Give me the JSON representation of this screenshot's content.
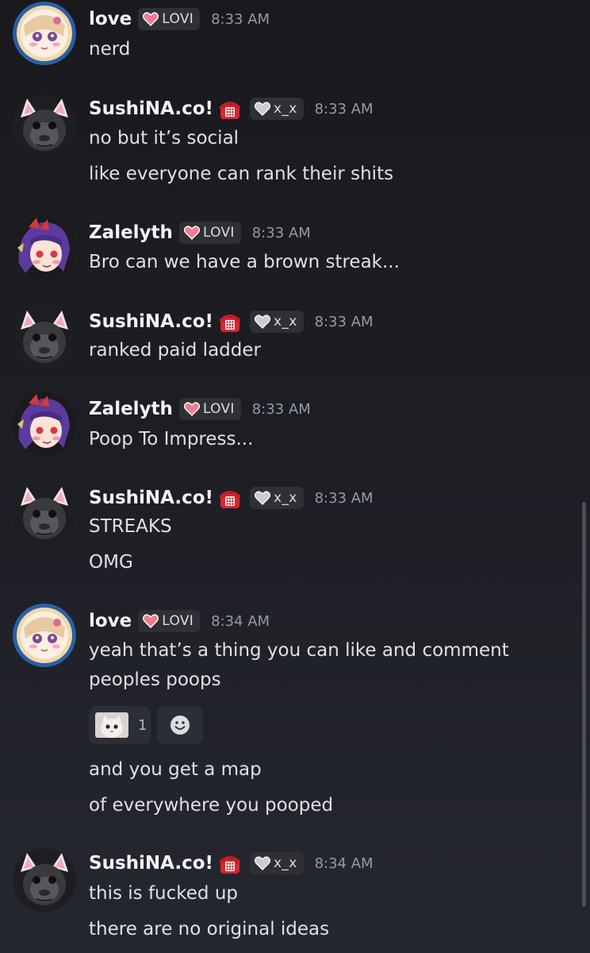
{
  "messages": [
    {
      "user": "love",
      "avatar": "love-avatar",
      "tag": "LOVI",
      "tag_heart": "pink",
      "time": "8:33 AM",
      "lines": [
        "nerd"
      ]
    },
    {
      "user": "SushiNA.co!",
      "avatar": "monkey-avatar",
      "phone_icon": true,
      "tag": "x_x",
      "tag_heart": "gray",
      "time": "8:33 AM",
      "lines": [
        "no but it’s social",
        "like everyone can rank their shits"
      ]
    },
    {
      "user": "Zalelyth",
      "avatar": "anime-avatar",
      "tag": "LOVI",
      "tag_heart": "pink",
      "time": "8:33 AM",
      "lines": [
        "Bro can we have a brown streak..."
      ]
    },
    {
      "user": "SushiNA.co!",
      "avatar": "monkey-avatar",
      "phone_icon": true,
      "tag": "x_x",
      "tag_heart": "gray",
      "time": "8:33 AM",
      "lines": [
        "ranked paid ladder"
      ]
    },
    {
      "user": "Zalelyth",
      "avatar": "anime-avatar",
      "tag": "LOVI",
      "tag_heart": "pink",
      "time": "8:33 AM",
      "lines": [
        "Poop To Impress..."
      ]
    },
    {
      "user": "SushiNA.co!",
      "avatar": "monkey-avatar",
      "phone_icon": true,
      "tag": "x_x",
      "tag_heart": "gray",
      "time": "8:33 AM",
      "lines": [
        "STREAKS",
        "OMG"
      ]
    },
    {
      "user": "love",
      "avatar": "love-avatar",
      "tag": "LOVI",
      "tag_heart": "pink",
      "time": "8:34 AM",
      "lines": [
        "yeah that’s a thing you can like and comment",
        "peoples poops"
      ],
      "reaction": {
        "emoji": "cat-emoji",
        "count": "1"
      },
      "after_lines": [
        "and you get a map",
        "of everywhere you pooped"
      ]
    },
    {
      "user": "SushiNA.co!",
      "avatar": "monkey-avatar",
      "phone_icon": true,
      "tag": "x_x",
      "tag_heart": "gray",
      "time": "8:34 AM",
      "lines": [
        "this is fucked up",
        "there are no original ideas"
      ]
    }
  ],
  "colors": {
    "background_top": "#1a191e",
    "background_bottom": "#25272f",
    "username": "#f2f3f5",
    "timestamp": "#949ba4",
    "tag_bg": "#2e3036",
    "heart_pink": "#f47b8f",
    "heart_gray": "#c9ccd1"
  }
}
